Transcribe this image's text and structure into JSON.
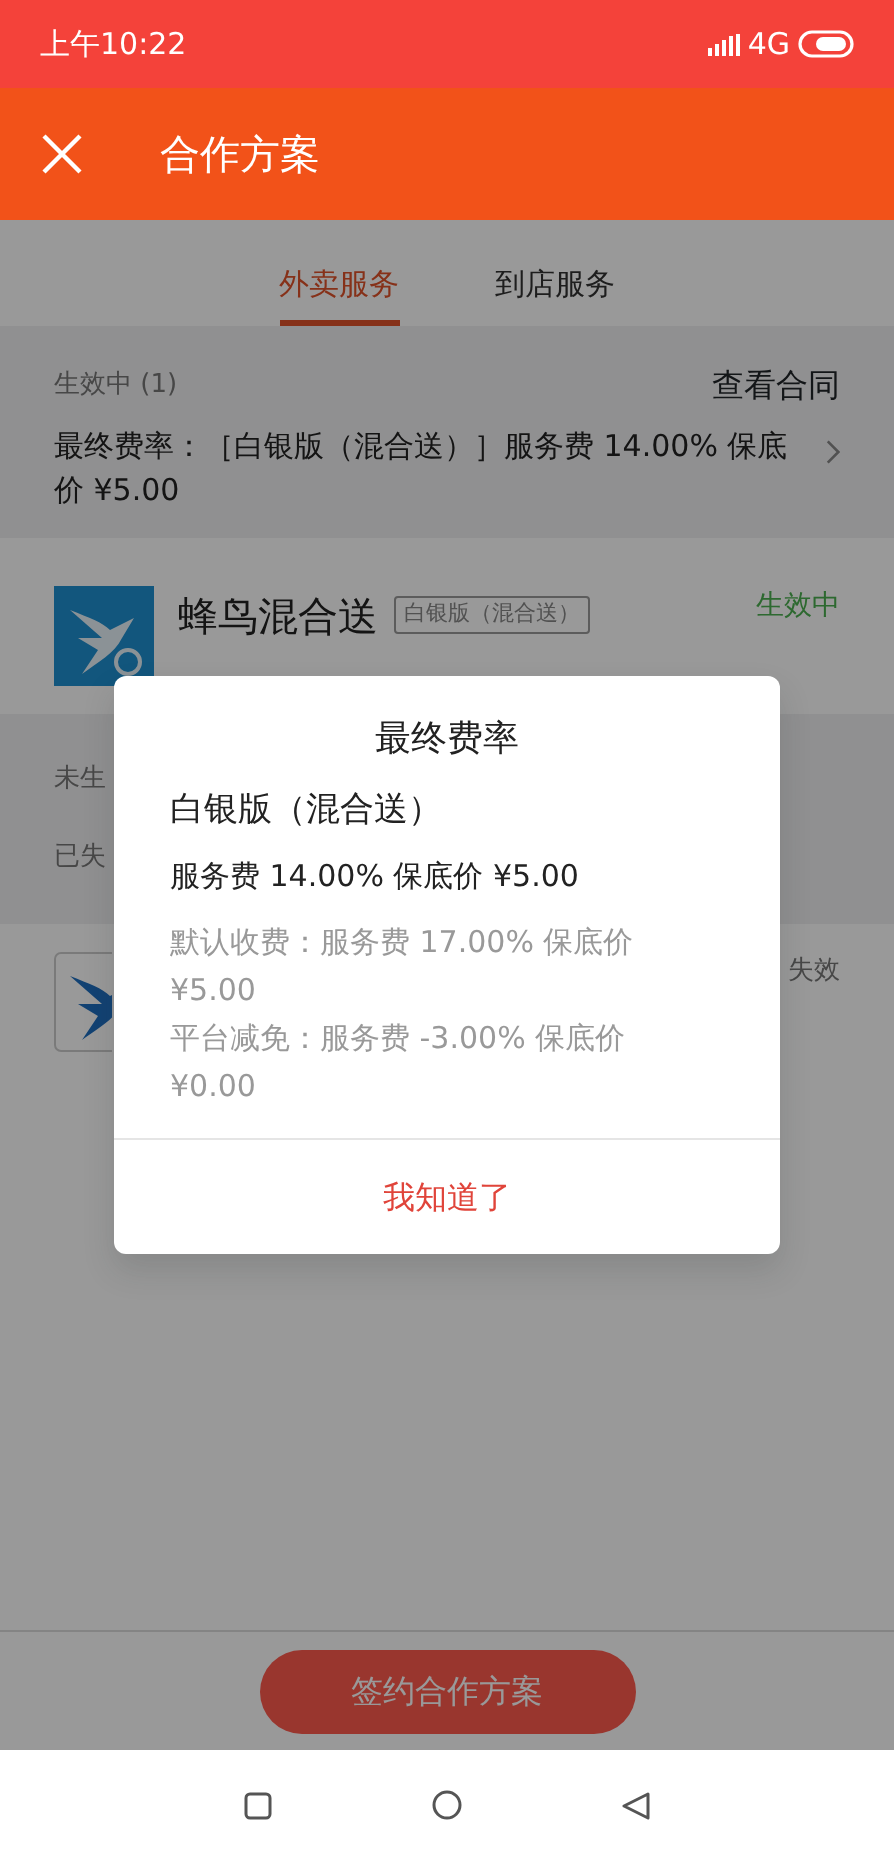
{
  "status_bar": {
    "time": "上午10:22",
    "network": "4G"
  },
  "app_bar": {
    "title": "合作方案"
  },
  "tabs": [
    {
      "label": "外卖服务",
      "selected": true
    },
    {
      "label": "到店服务",
      "selected": false
    }
  ],
  "active_section": {
    "heading": "生效中 (1)",
    "link": "查看合同",
    "rate_text": "最终费率：［白银版（混合送）］服务费 14.00% 保底价 ¥5.00"
  },
  "active_item": {
    "name": "蜂鸟混合送",
    "tag": "白银版（混合送）",
    "status": "生效中"
  },
  "pending_heading": "未生",
  "expired_heading": "已失",
  "expired_item": {
    "status": "失效"
  },
  "sign_button": "签约合作方案",
  "dialog": {
    "title": "最终费率",
    "plan": "白银版（混合送）",
    "fee": "服务费 14.00% 保底价 ¥5.00",
    "details": [
      "默认收费：服务费 17.00% 保底价 ¥5.00",
      "平台减免：服务费 -3.00% 保底价 ¥0.00"
    ],
    "button": "我知道了"
  }
}
